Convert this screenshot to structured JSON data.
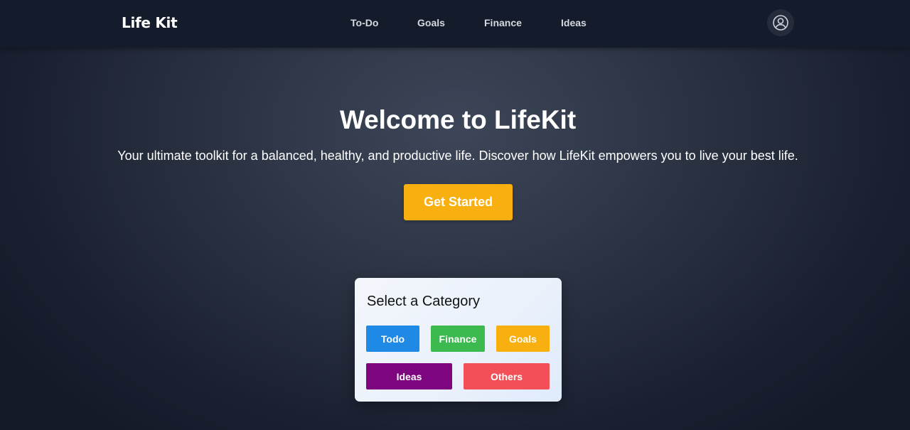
{
  "nav": {
    "brand": "Life Kit",
    "links": [
      "To-Do",
      "Goals",
      "Finance",
      "Ideas"
    ],
    "avatar_icon": "user-circle-icon"
  },
  "hero": {
    "title": "Welcome to LifeKit",
    "subtitle": "Your ultimate toolkit for a balanced, healthy, and productive life. Discover how LifeKit empowers you to live your best life.",
    "cta_label": "Get Started",
    "cta_color": "#f7b010"
  },
  "category_card": {
    "title": "Select a Category",
    "buttons": [
      {
        "label": "Todo",
        "color": "#1f8ae6"
      },
      {
        "label": "Finance",
        "color": "#3cb94f"
      },
      {
        "label": "Goals",
        "color": "#f7b010"
      },
      {
        "label": "Ideas",
        "color": "#7d0580"
      },
      {
        "label": "Others",
        "color": "#f25056"
      }
    ]
  }
}
